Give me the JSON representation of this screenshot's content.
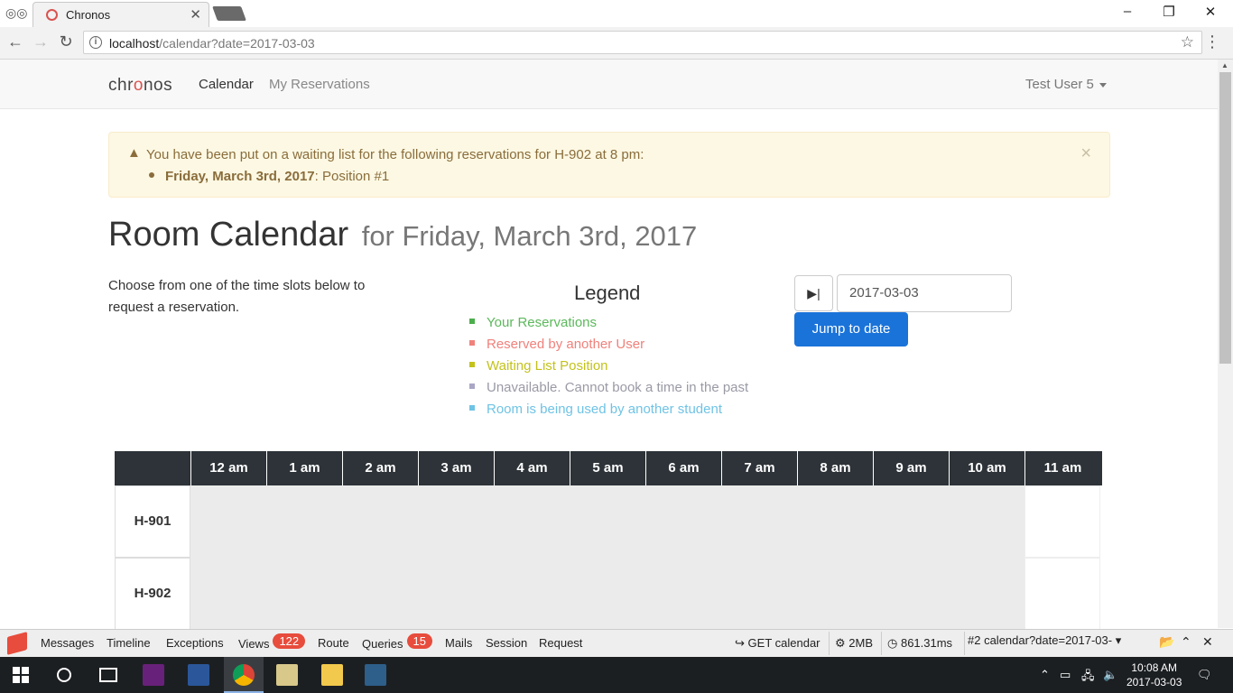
{
  "browser": {
    "tab_title": "Chronos",
    "url_host": "localhost",
    "url_path": "/calendar?date=2017-03-03"
  },
  "navbar": {
    "brand_pre": "chr",
    "brand_o": "o",
    "brand_post": "nos",
    "links": [
      "Calendar",
      "My Reservations"
    ],
    "user": "Test User 5"
  },
  "alert": {
    "message": "You have been put on a waiting list for the following reservations for H-902 at 8 pm:",
    "item_date": "Friday, March 3rd, 2017",
    "item_position": ": Position #1",
    "close": "×"
  },
  "page": {
    "title": "Room Calendar",
    "subtitle": "for Friday, March 3rd, 2017",
    "intro": "Choose from one of the time slots below to request a reservation."
  },
  "legend": {
    "title": "Legend",
    "items": [
      {
        "label": "Your Reservations",
        "color": "#5cb85c",
        "square": "#4cae4c"
      },
      {
        "label": "Reserved by another User",
        "color": "#f0817b",
        "square": "#f0817b"
      },
      {
        "label": "Waiting List Position",
        "color": "#c3c21b",
        "square": "#c3c21b"
      },
      {
        "label": "Unavailable. Cannot book a time in the past",
        "color": "#9a9aa6",
        "square": "#a9a6c6"
      },
      {
        "label": "Room is being used by another student",
        "color": "#6fc3e5",
        "square": "#6fc3e5"
      }
    ]
  },
  "datepicker": {
    "value": "2017-03-03",
    "jump_label": "Jump to date"
  },
  "calendar": {
    "hours": [
      "12 am",
      "1 am",
      "2 am",
      "3 am",
      "4 am",
      "5 am",
      "6 am",
      "7 am",
      "8 am",
      "9 am",
      "10 am",
      "11 am"
    ],
    "rooms": [
      "H-901",
      "H-902"
    ]
  },
  "debugbar": {
    "tabs": [
      "Messages",
      "Timeline",
      "Exceptions",
      "Views",
      "Route",
      "Queries",
      "Mails",
      "Session",
      "Request"
    ],
    "views_count": "122",
    "queries_count": "15",
    "method": "GET calendar",
    "memory": "2MB",
    "time": "861.31ms",
    "request_select": "#2 calendar?date=2017-03-"
  },
  "taskbar": {
    "time": "10:08 AM",
    "date": "2017-03-03"
  }
}
